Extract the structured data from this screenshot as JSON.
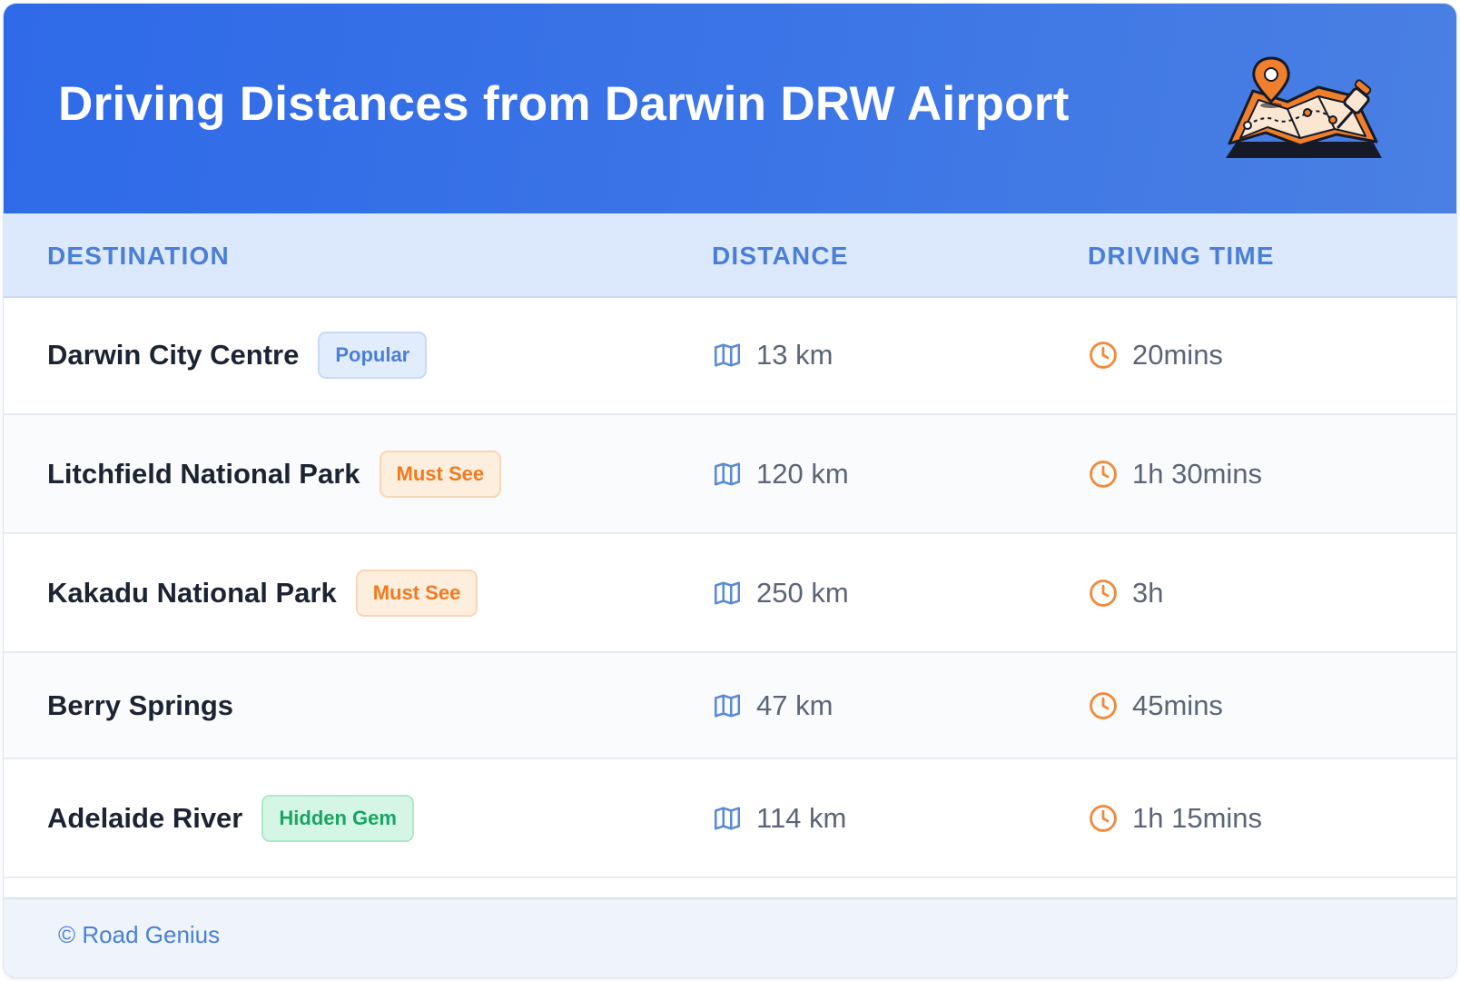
{
  "header": {
    "title": "Driving Distances from Darwin DRW Airport",
    "illustration": "map-with-pins-illustration"
  },
  "table": {
    "columns": [
      "DESTINATION",
      "DISTANCE",
      "DRIVING TIME"
    ],
    "rows": [
      {
        "destination": "Darwin City Centre",
        "badge": "Popular",
        "badge_type": "popular",
        "distance": "13 km",
        "time": "20mins"
      },
      {
        "destination": "Litchfield National Park",
        "badge": "Must See",
        "badge_type": "must",
        "distance": "120 km",
        "time": "1h 30mins"
      },
      {
        "destination": "Kakadu National Park",
        "badge": "Must See",
        "badge_type": "must",
        "distance": "250 km",
        "time": "3h"
      },
      {
        "destination": "Berry Springs",
        "badge": "",
        "badge_type": "",
        "distance": "47 km",
        "time": "45mins"
      },
      {
        "destination": "Adelaide River",
        "badge": "Hidden Gem",
        "badge_type": "gem",
        "distance": "114 km",
        "time": "1h 15mins"
      }
    ]
  },
  "icons": {
    "distance": "map-icon",
    "time": "clock-icon"
  },
  "footer": {
    "credit": "© Road Genius"
  },
  "colors": {
    "header_blue": "#2f6ae8",
    "accent_blue": "#4a7fd8",
    "orange": "#f07a20",
    "green": "#1aa463"
  }
}
